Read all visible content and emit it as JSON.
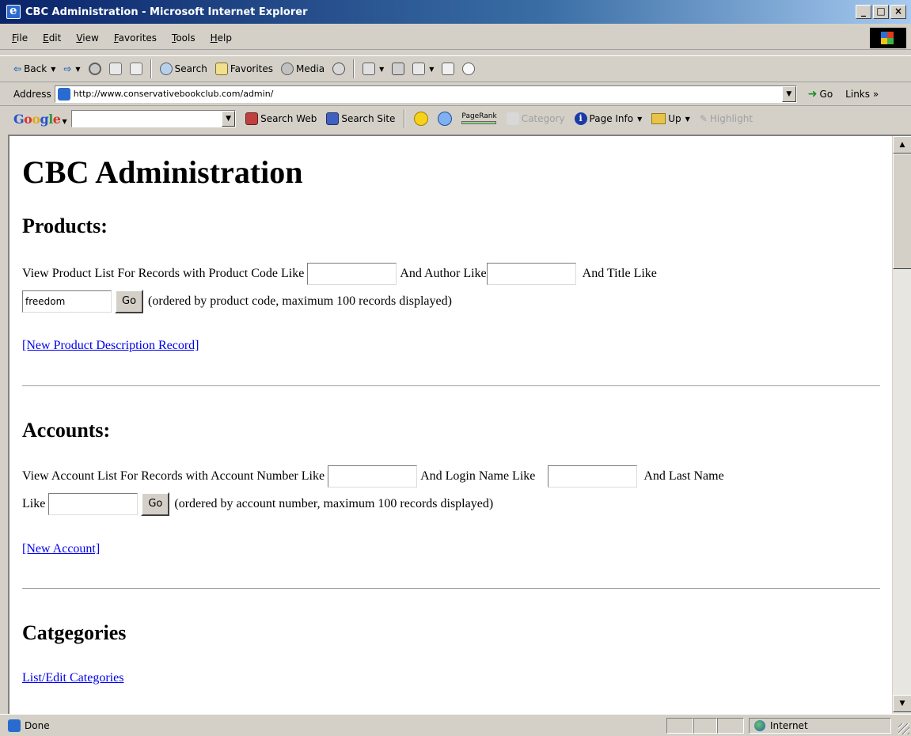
{
  "window": {
    "title": "CBC Administration - Microsoft Internet Explorer",
    "minimize": "_",
    "maximize": "□",
    "close": "×"
  },
  "menu": [
    "File",
    "Edit",
    "View",
    "Favorites",
    "Tools",
    "Help"
  ],
  "toolbar": {
    "back": "Back",
    "forward_caret": "▾",
    "search": "Search",
    "favorites": "Favorites",
    "media": "Media"
  },
  "address": {
    "label": "Address",
    "url": "http://www.conservativebookclub.com/admin/",
    "go": "Go",
    "links": "Links »"
  },
  "googlebar": {
    "logo": [
      "G",
      "o",
      "o",
      "g",
      "l",
      "e"
    ],
    "search_web": "Search Web",
    "search_site": "Search Site",
    "pagerank": "PageRank",
    "category": "Category",
    "page_info": "Page Info",
    "up": "Up",
    "highlight": "Highlight"
  },
  "page": {
    "title": "CBC Administration",
    "products": {
      "heading": "Products:",
      "line1_a": "View Product List For Records with Product Code Like",
      "line1_b": "And Author Like",
      "line1_c": "And Title Like",
      "code_value": "",
      "author_value": "",
      "title_value": "freedom",
      "go": "Go",
      "note": "(ordered by product code, maximum 100 records displayed)",
      "new_link": "[New Product Description Record]"
    },
    "accounts": {
      "heading": "Accounts:",
      "line1_a": "View Account List For Records with Account Number Like",
      "line1_b": "And Login Name Like",
      "line1_c": "And Last Name",
      "line2_a": "Like",
      "number_value": "",
      "login_value": "",
      "lastname_value": "",
      "go": "Go",
      "note": "(ordered by account number, maximum 100 records displayed)",
      "new_link": "[New Account]"
    },
    "categories": {
      "heading": "Catgegories",
      "link": "List/Edit Categories"
    }
  },
  "status": {
    "text": "Done",
    "zone": "Internet"
  },
  "colors": {
    "titlebar": "#0a246a",
    "link": "#0000ee",
    "chrome": "#d4d0c8"
  }
}
